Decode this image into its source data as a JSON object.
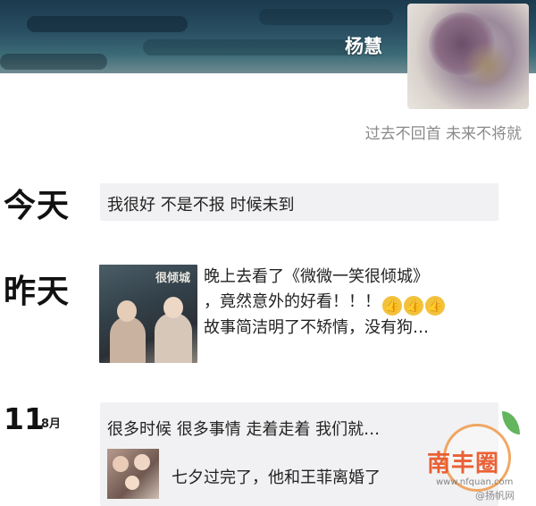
{
  "profile": {
    "username": "杨慧",
    "signature": "过去不回首 未来不将就"
  },
  "timeline": {
    "today": {
      "label": "今天",
      "text": "我很好 不是不报 时候未到"
    },
    "yesterday": {
      "label": "昨天",
      "thumb_title": "很倾城",
      "lines": [
        "晚上去看了《微微一笑很倾城》",
        "，竟然意外的好看！！！",
        "故事简洁明了不矫情，没有狗…"
      ],
      "thumbs_glyph": "👍"
    },
    "aug11": {
      "day": "11",
      "month": "8月",
      "headline": "很多时候 很多事情 走着走着 我们就…",
      "snippet": "七夕过完了，他和王菲离婚了"
    }
  },
  "watermark": {
    "title": "南丰圈",
    "url": "www.nfquan.com",
    "weibo": "@扬帆网"
  },
  "colors": {
    "accent_orange": "#e85424",
    "leaf_green": "#48a842",
    "bubble_bg": "#f1f1f3"
  }
}
